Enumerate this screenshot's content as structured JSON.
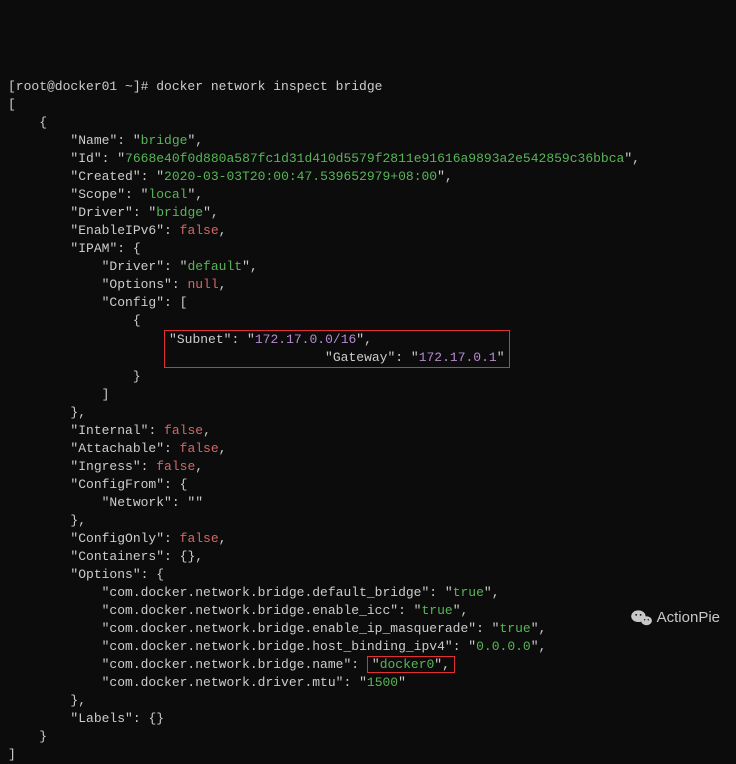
{
  "prompt": "[root@docker01 ~]# docker network inspect bridge",
  "json": {
    "Name": "bridge",
    "Id": "7668e40f0d880a587fc1d31d410d5579f2811e91616a9893a2e542859c36bbca",
    "Created": "2020-03-03T20:00:47.539652979+08:00",
    "Scope": "local",
    "Driver": "bridge",
    "EnableIPv6": "false",
    "IPAM": {
      "Driver": "default",
      "Options": "null",
      "Config": {
        "Subnet_ip": "172.17.0.0",
        "Subnet_cidr": "/16",
        "Gateway": "172.17.0.1"
      }
    },
    "Internal": "false",
    "Attachable": "false",
    "Ingress": "false",
    "ConfigFrom": {
      "Network": ""
    },
    "ConfigOnly": "false",
    "Containers": "{}",
    "Options": {
      "default_bridge_key": "com.docker.network.bridge.default_bridge",
      "default_bridge": "true",
      "enable_icc_key": "com.docker.network.bridge.enable_icc",
      "enable_icc": "true",
      "enable_ip_masquerade_key": "com.docker.network.bridge.enable_ip_masquerade",
      "enable_ip_masquerade": "true",
      "host_binding_ipv4_key": "com.docker.network.bridge.host_binding_ipv4",
      "host_binding_ipv4": "0.0.0.0",
      "name_key": "com.docker.network.bridge.name",
      "name": "docker0",
      "mtu_key": "com.docker.network.driver.mtu",
      "mtu": "1500"
    },
    "Labels": "{}"
  },
  "labels": {
    "Name": "Name",
    "Id": "Id",
    "Created": "Created",
    "Scope": "Scope",
    "Driver": "Driver",
    "EnableIPv6": "EnableIPv6",
    "IPAM": "IPAM",
    "Options": "Options",
    "Config": "Config",
    "Subnet": "Subnet",
    "Gateway": "Gateway",
    "Internal": "Internal",
    "Attachable": "Attachable",
    "Ingress": "Ingress",
    "ConfigFrom": "ConfigFrom",
    "Network": "Network",
    "ConfigOnly": "ConfigOnly",
    "Containers": "Containers",
    "Labels": "Labels"
  },
  "watermark": "ActionPie"
}
